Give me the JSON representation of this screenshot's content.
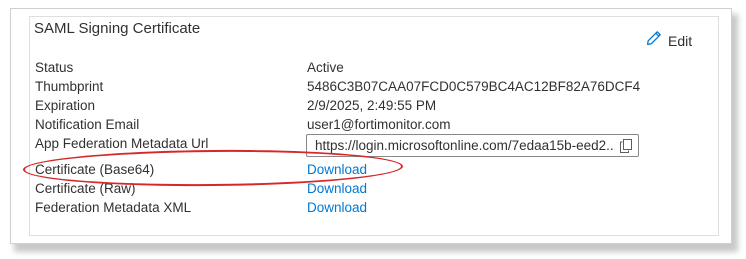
{
  "section": {
    "title": "SAML Signing Certificate",
    "edit_label": "Edit"
  },
  "fields": {
    "status": {
      "label": "Status",
      "value": "Active"
    },
    "thumbprint": {
      "label": "Thumbprint",
      "value": "5486C3B07CAA07FCD0C579BC4AC12BF82A76DCF4"
    },
    "expiration": {
      "label": "Expiration",
      "value": "2/9/2025, 2:49:55 PM"
    },
    "notification_email": {
      "label": "Notification Email",
      "value": "user1@fortimonitor.com"
    },
    "metadata_url": {
      "label": "App Federation Metadata Url",
      "value": "https://login.microsoftonline.com/7edaa15b-eed2..."
    },
    "cert_base64": {
      "label": "Certificate (Base64)",
      "link": "Download"
    },
    "cert_raw": {
      "label": "Certificate (Raw)",
      "link": "Download"
    },
    "federation_xml": {
      "label": "Federation Metadata XML",
      "link": "Download"
    }
  },
  "icons": {
    "edit": "pencil-icon",
    "copy": "copy-icon"
  },
  "colors": {
    "link": "#0078d4",
    "highlight_oval": "#d62828",
    "text": "#323130"
  }
}
